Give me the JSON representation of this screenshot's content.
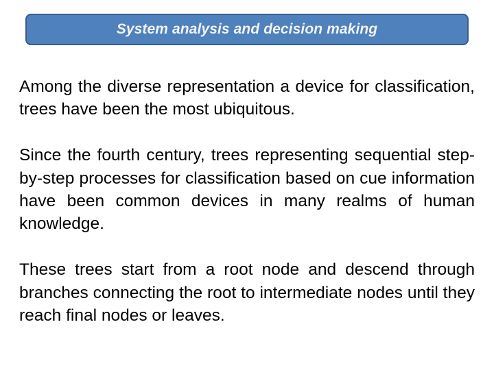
{
  "header": {
    "title": "System analysis and decision making"
  },
  "colors": {
    "title_bar_fill": "#4f81bd",
    "title_bar_border": "#385d8a",
    "title_text": "#f2f2f2",
    "body_text": "#000000",
    "background": "#ffffff"
  },
  "content": {
    "paragraphs": [
      "Among the diverse representation a device for classification, trees have been the most ubiquitous.",
      "Since the fourth century, trees representing sequential step-by-step processes for classification based on cue information have been common devices in many realms of human knowledge.",
      "These trees start from a root node and descend through branches connecting the root to intermediate nodes until they reach final nodes or leaves."
    ]
  }
}
